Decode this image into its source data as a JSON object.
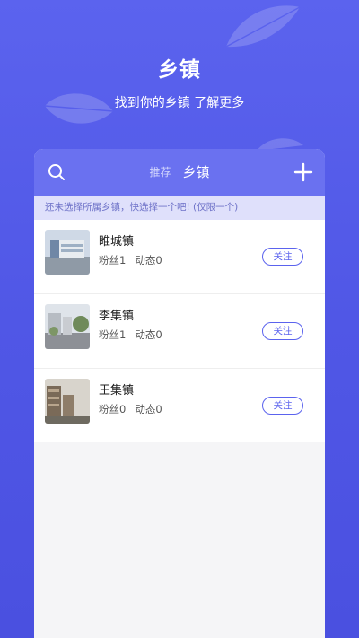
{
  "hero": {
    "title": "乡镇",
    "subtitle": "找到你的乡镇 了解更多"
  },
  "header": {
    "tabs": [
      {
        "label": "推荐",
        "active": false
      },
      {
        "label": "乡镇",
        "active": true
      }
    ],
    "search_icon": "search-icon",
    "add_icon": "plus-icon"
  },
  "notice": "还未选择所属乡镇，快选择一个吧! (仅限一个)",
  "towns": [
    {
      "name": "睢城镇",
      "fans": "粉丝1",
      "posts": "动态0",
      "follow_label": "关注"
    },
    {
      "name": "李集镇",
      "fans": "粉丝1",
      "posts": "动态0",
      "follow_label": "关注"
    },
    {
      "name": "王集镇",
      "fans": "粉丝0",
      "posts": "动态0",
      "follow_label": "关注"
    }
  ],
  "colors": {
    "accent": "#5b63ee",
    "header": "#6a71f0",
    "notice_bg": "#dfe0fb"
  }
}
